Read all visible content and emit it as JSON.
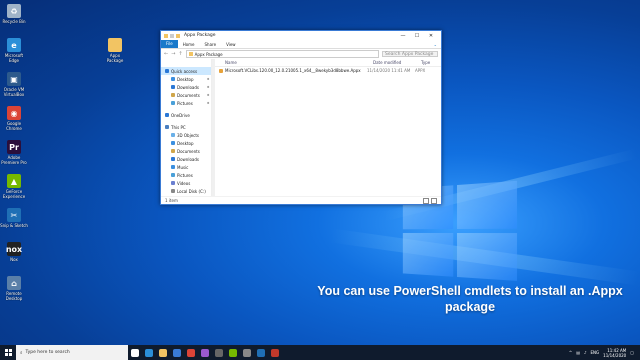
{
  "desktop": {
    "icons": [
      {
        "label": "Recycle Bin",
        "icon": "recycle-bin-icon",
        "color": "#9fb3c8",
        "glyph": "♻"
      },
      {
        "label": "Microsoft Edge",
        "icon": "edge-icon",
        "color": "#2b8fd8",
        "glyph": "e"
      },
      {
        "label": "Oracle VM VirtualBox",
        "icon": "virtualbox-icon",
        "color": "#2d5a8c",
        "glyph": "▣"
      },
      {
        "label": "Google Chrome",
        "icon": "chrome-icon",
        "color": "#db4437",
        "glyph": "◉"
      },
      {
        "label": "Adobe Premiere Pro",
        "icon": "premiere-icon",
        "color": "#2a0f3c",
        "glyph": "Pr"
      },
      {
        "label": "GeForce Experience",
        "icon": "geforce-icon",
        "color": "#76b900",
        "glyph": "▲"
      },
      {
        "label": "Snip & Sketch",
        "icon": "snip-icon",
        "color": "#1f6fb5",
        "glyph": "✂"
      },
      {
        "label": "Nox",
        "icon": "nox-icon",
        "color": "#222",
        "glyph": "nox"
      },
      {
        "label": "Remote Desktop",
        "icon": "remote-desktop-icon",
        "color": "#5a7fa8",
        "glyph": "⌂"
      }
    ],
    "package_icon": {
      "label": "Appx Package",
      "icon": "folder-icon",
      "color": "#f2c463"
    }
  },
  "explorer": {
    "title": "Appx Package",
    "minimize": "—",
    "maximize": "☐",
    "close": "✕",
    "tabs": [
      "File",
      "Home",
      "Share",
      "View"
    ],
    "address": "Appx Package",
    "search_placeholder": "Search Appx Package",
    "nav": [
      {
        "label": "Quick access",
        "sel": true,
        "color": "#2b78d6"
      },
      {
        "label": "Desktop",
        "sub": true,
        "pin": true,
        "color": "#3b8fe0"
      },
      {
        "label": "Downloads",
        "sub": true,
        "pin": true,
        "color": "#2b78d6"
      },
      {
        "label": "Documents",
        "sub": true,
        "pin": true,
        "color": "#d0a64a"
      },
      {
        "label": "Pictures",
        "sub": true,
        "pin": true,
        "color": "#4aa0d8"
      },
      {
        "label": "",
        "sub": false,
        "color": "transparent"
      },
      {
        "label": "OneDrive",
        "sub": false,
        "color": "#2b78d6"
      },
      {
        "label": "",
        "sub": false,
        "color": "transparent"
      },
      {
        "label": "This PC",
        "sub": false,
        "color": "#4a7fc0"
      },
      {
        "label": "3D Objects",
        "sub": true,
        "color": "#6ab0e8"
      },
      {
        "label": "Desktop",
        "sub": true,
        "color": "#3b8fe0"
      },
      {
        "label": "Documents",
        "sub": true,
        "color": "#d0a64a"
      },
      {
        "label": "Downloads",
        "sub": true,
        "color": "#2b78d6"
      },
      {
        "label": "Music",
        "sub": true,
        "color": "#3b8fe0"
      },
      {
        "label": "Pictures",
        "sub": true,
        "color": "#4aa0d8"
      },
      {
        "label": "Videos",
        "sub": true,
        "color": "#6a7fd0"
      },
      {
        "label": "Local Disk (C:)",
        "sub": true,
        "color": "#888"
      }
    ],
    "columns": {
      "name": "Name",
      "date": "Date modified",
      "type": "Type"
    },
    "files": [
      {
        "name": "Microsoft.VCLibs.120.00_12.0.21005.1_x64__8wekyb3d8bbwe.Appx",
        "date": "11/14/2020 11:41 AM",
        "type": "APPX"
      }
    ],
    "status": "1 item"
  },
  "caption": {
    "line1": "You can use PowerShell cmdlets to install an .Appx",
    "line2": "package"
  },
  "taskbar": {
    "search_placeholder": "Type here to search",
    "apps": [
      {
        "icon": "task-view-icon",
        "color": "#ffffff"
      },
      {
        "icon": "edge-icon",
        "color": "#2b8fd8"
      },
      {
        "icon": "file-explorer-icon",
        "color": "#f2c463"
      },
      {
        "icon": "store-icon",
        "color": "#3a7bd5"
      },
      {
        "icon": "chrome-icon",
        "color": "#db4437"
      },
      {
        "icon": "premiere-icon",
        "color": "#9b59d0"
      },
      {
        "icon": "camera-icon",
        "color": "#666"
      },
      {
        "icon": "geforce-icon",
        "color": "#76b900"
      },
      {
        "icon": "settings-icon",
        "color": "#888"
      },
      {
        "icon": "snip-icon",
        "color": "#1f6fb5"
      },
      {
        "icon": "app-icon",
        "color": "#c0392b"
      }
    ],
    "time": "11:42 AM",
    "date": "11/14/2020",
    "lang": "ENG"
  }
}
